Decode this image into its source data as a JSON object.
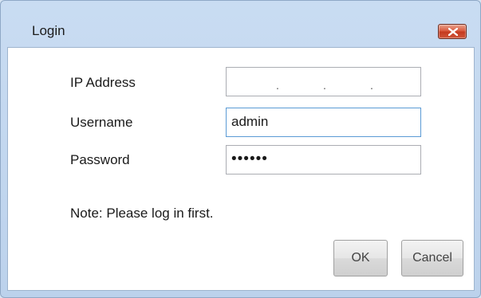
{
  "window": {
    "title": "Login"
  },
  "form": {
    "ip_address_label": "IP Address",
    "ip_address_value": ". . .",
    "username_label": "Username",
    "username_value": "admin",
    "password_label": "Password",
    "password_value": "••••••"
  },
  "note": "Note: Please log in first.",
  "buttons": {
    "ok_label": "OK",
    "cancel_label": "Cancel"
  },
  "colors": {
    "close_button": "#d0553a",
    "focus_border": "#5b9bd5"
  },
  "icons": {
    "close": "close-icon"
  }
}
